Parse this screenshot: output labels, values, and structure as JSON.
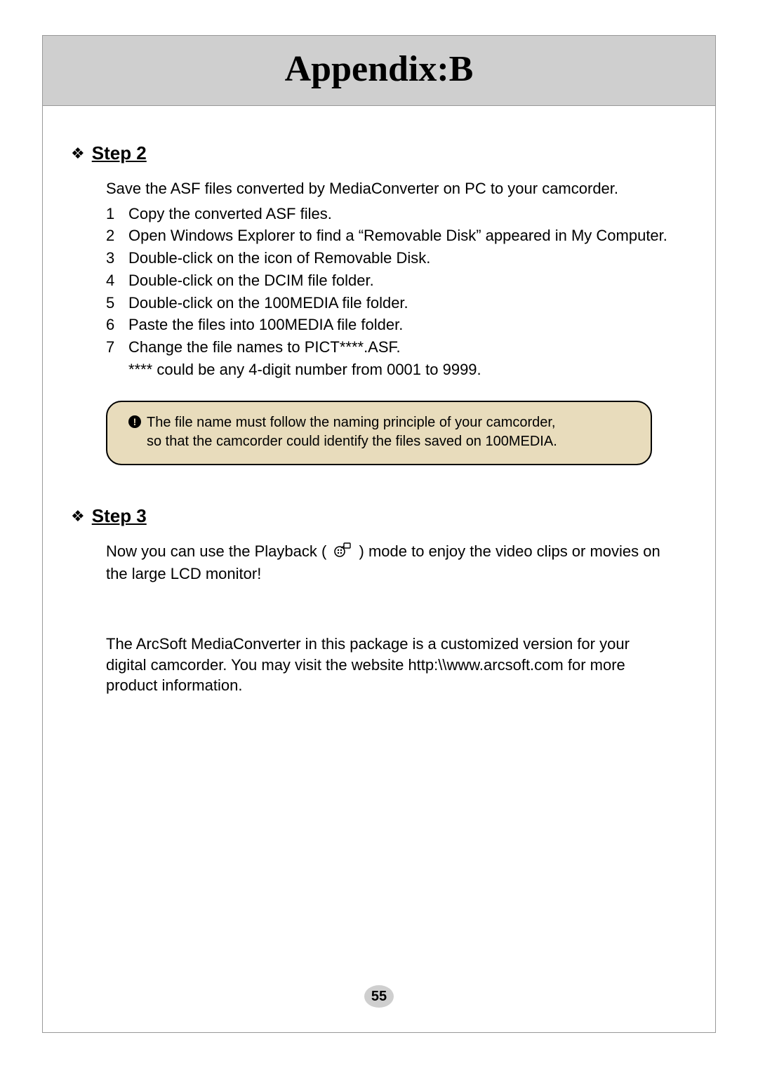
{
  "header": {
    "title": "Appendix:B"
  },
  "step2": {
    "heading": "Step 2",
    "intro": "Save the ASF files converted by MediaConverter on PC to your camcorder.",
    "items": [
      {
        "n": "1",
        "text": "Copy the converted ASF files."
      },
      {
        "n": "2",
        "text": "Open Windows Explorer to find a “Removable Disk” appeared in My Computer."
      },
      {
        "n": "3",
        "text": "Double-click on the icon of Removable Disk."
      },
      {
        "n": "4",
        "text": "Double-click on the DCIM file folder."
      },
      {
        "n": "5",
        "text": "Double-click on the 100MEDIA file folder."
      },
      {
        "n": "6",
        "text": "Paste the files into 100MEDIA file folder."
      },
      {
        "n": "7",
        "text": "Change the file names to PICT****.ASF."
      }
    ],
    "subnote": "**** could be any 4-digit number from 0001 to 9999.",
    "notebox": {
      "alert": "!",
      "line1": "The file name must follow the naming principle of your camcorder,",
      "line2": "so that the camcorder could identify the files saved on 100MEDIA."
    }
  },
  "step3": {
    "heading": "Step 3",
    "text_before": "Now you can use the Playback (",
    "text_after": ") mode to enjoy the video clips or movies on the large LCD monitor!"
  },
  "footer_paragraph": "The ArcSoft MediaConverter in this package is a customized version for your digital camcorder. You may visit the website http:\\\\www.arcsoft.com for more product information.",
  "page_number": "55",
  "bullet_glyph": "❖"
}
